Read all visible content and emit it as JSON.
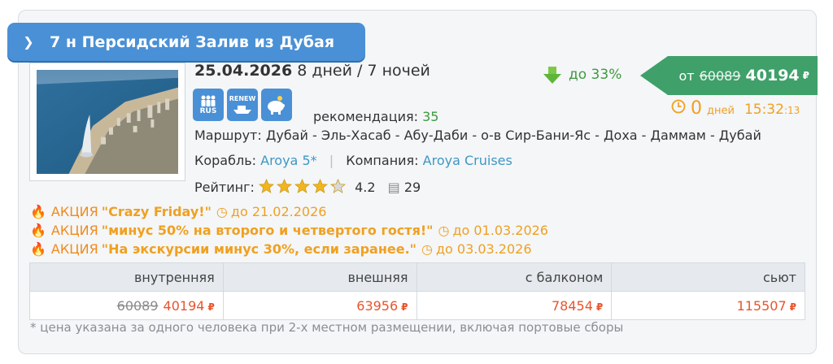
{
  "tour": {
    "title": "7 н Персидский Залив из Дубая",
    "date": "25.04.2026",
    "duration": "8 дней / 7 ночей",
    "badges": [
      {
        "icon": "people-icon",
        "label": "RUS"
      },
      {
        "icon": "renew-icon",
        "label": "RENEW"
      },
      {
        "icon": "piggy-bank-icon",
        "label": ""
      }
    ],
    "recommendation_label": "рекомендация:",
    "recommendation_value": "35",
    "route_label": "Маршрут:",
    "route": "Дубай - Эль-Хасаб - Абу-Даби - о-в Сир-Бани-Яс - Доха - Даммам - Дубай",
    "ship_label": "Корабль:",
    "ship": "Aroya 5*",
    "company_label": "Компания:",
    "company": "Aroya Cruises",
    "rating_label": "Рейтинг:",
    "rating": "4.2",
    "rating_value": 4.2,
    "reviews": "29"
  },
  "discount": {
    "label": "до 33%"
  },
  "price_tag": {
    "prefix": "от",
    "old_price": "60089",
    "new_price": "40194",
    "currency": "₽"
  },
  "timer": {
    "days": "0",
    "days_label": "дней",
    "time": "15:32",
    "seconds": ":13"
  },
  "promos": [
    {
      "label": "АКЦИЯ",
      "title": "\"Crazy Friday!\"",
      "until": "до 21.02.2026"
    },
    {
      "label": "АКЦИЯ",
      "title": "\"минус 50% на второго и четвертого гостя!\"",
      "until": "до 01.03.2026"
    },
    {
      "label": "АКЦИЯ",
      "title": "\"На экскурсии минус 30%, если заранее.\"",
      "until": "до 03.03.2026"
    }
  ],
  "cabins": {
    "headers": [
      "внутренняя",
      "внешняя",
      "с балконом",
      "сьют"
    ],
    "old_prices": [
      "60089",
      "",
      "",
      ""
    ],
    "prices": [
      "40194",
      "63956",
      "78454",
      "115507"
    ],
    "currency": "₽"
  },
  "footnote": "* цена указана за одного человека при 2-х местном размещении, включая портовые сборы",
  "colors": {
    "ribbon": "#4a90d6",
    "price_tag": "#3fa06a",
    "discount": "#3f9a3f",
    "promo_orange": "#f08a1c",
    "promo_title": "#f0a020",
    "price_red": "#e8542c",
    "link": "#3f97c4"
  }
}
